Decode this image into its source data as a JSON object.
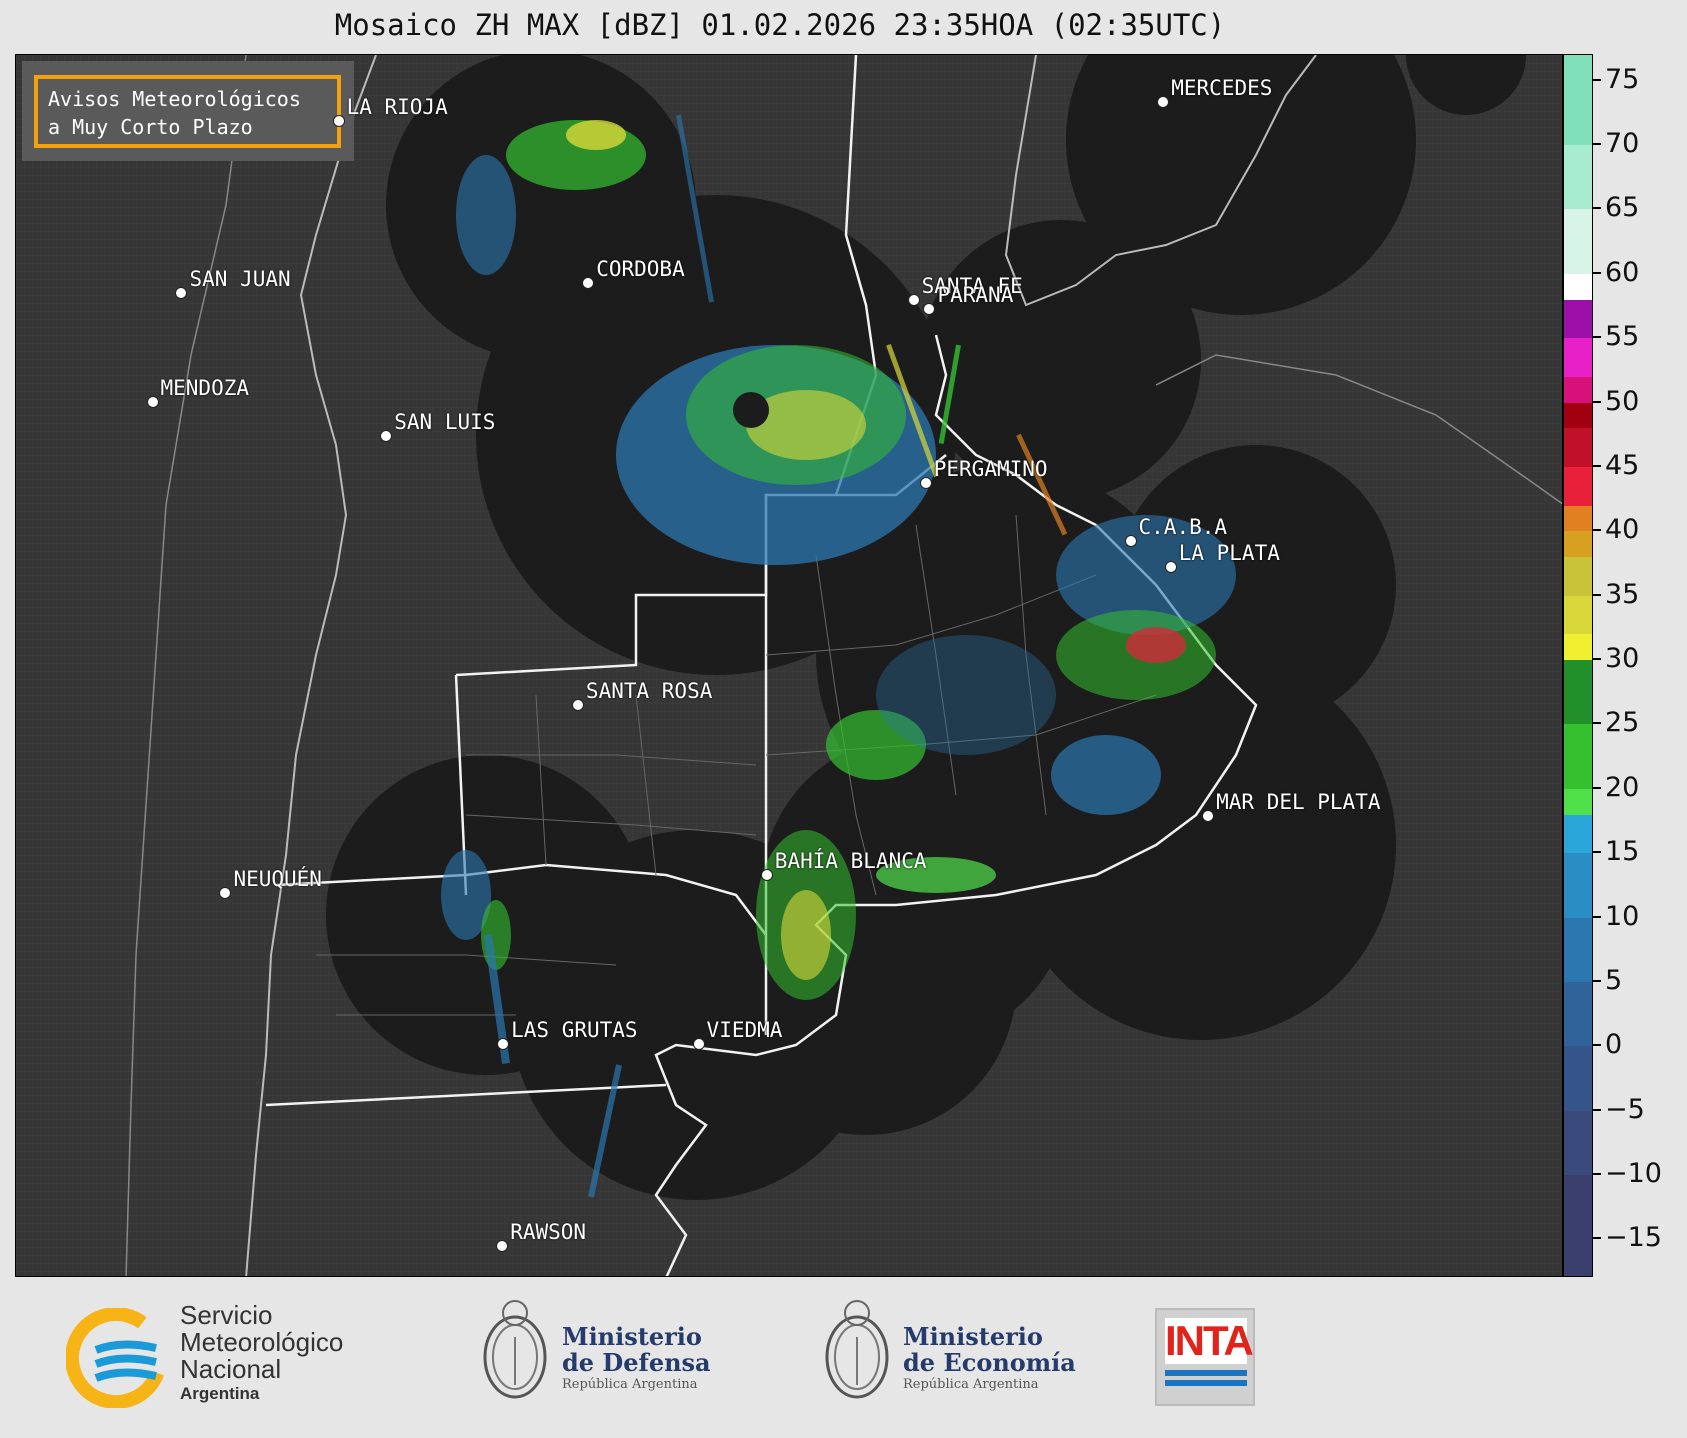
{
  "title": "Mosaico ZH MAX [dBZ] 01.02.2026 23:35HOA (02:35UTC)",
  "warning_box": {
    "line1": "Avisos Meteorológicos",
    "line2": "a Muy Corto Plazo",
    "border_color": "#f3a10c"
  },
  "cities": [
    {
      "name": "LA RIOJA",
      "lon": -66.85,
      "lat": -29.41
    },
    {
      "name": "MERCEDES",
      "lon": -58.03,
      "lat": -29.18
    },
    {
      "name": "SAN JUAN",
      "lon": -68.53,
      "lat": -31.54
    },
    {
      "name": "CORDOBA",
      "lon": -64.18,
      "lat": -31.42
    },
    {
      "name": "SANTA FE",
      "lon": -60.7,
      "lat": -31.63
    },
    {
      "name": "PARANA",
      "lon": -60.53,
      "lat": -31.73
    },
    {
      "name": "MENDOZA",
      "lon": -68.84,
      "lat": -32.89
    },
    {
      "name": "SAN LUIS",
      "lon": -66.34,
      "lat": -33.3
    },
    {
      "name": "PERGAMINO",
      "lon": -60.57,
      "lat": -33.89
    },
    {
      "name": "C.A.B.A",
      "lon": -58.38,
      "lat": -34.6
    },
    {
      "name": "LA PLATA",
      "lon": -57.95,
      "lat": -34.92
    },
    {
      "name": "SANTA ROSA",
      "lon": -64.29,
      "lat": -36.62
    },
    {
      "name": "MAR DEL PLATA",
      "lon": -57.55,
      "lat": -38.0
    },
    {
      "name": "BAHÍA BLANCA",
      "lon": -62.27,
      "lat": -38.72
    },
    {
      "name": "NEUQUÉN",
      "lon": -68.06,
      "lat": -38.95
    },
    {
      "name": "LAS GRUTAS",
      "lon": -65.09,
      "lat": -40.81
    },
    {
      "name": "VIEDMA",
      "lon": -63.0,
      "lat": -40.81
    },
    {
      "name": "RAWSON",
      "lon": -65.1,
      "lat": -43.3
    }
  ],
  "colorbar": {
    "min": -18,
    "max": 77,
    "ticks": [
      "75",
      "70",
      "65",
      "60",
      "55",
      "50",
      "45",
      "40",
      "35",
      "30",
      "25",
      "20",
      "15",
      "10",
      "5",
      "0",
      "−5",
      "−10",
      "−15"
    ],
    "tick_values": [
      75,
      70,
      65,
      60,
      55,
      50,
      45,
      40,
      35,
      30,
      25,
      20,
      15,
      10,
      5,
      0,
      -5,
      -10,
      -15
    ],
    "stops": [
      {
        "from": -18,
        "to": -10,
        "color": "#3a3f6e"
      },
      {
        "from": -10,
        "to": -5,
        "color": "#3a4a7a"
      },
      {
        "from": -5,
        "to": 0,
        "color": "#35558a"
      },
      {
        "from": 0,
        "to": 5,
        "color": "#2f6399"
      },
      {
        "from": 5,
        "to": 10,
        "color": "#2b78b0"
      },
      {
        "from": 10,
        "to": 15,
        "color": "#2a8ec4"
      },
      {
        "from": 15,
        "to": 18,
        "color": "#2aa6d8"
      },
      {
        "from": 18,
        "to": 20,
        "color": "#4fe04a"
      },
      {
        "from": 20,
        "to": 25,
        "color": "#35c030"
      },
      {
        "from": 25,
        "to": 30,
        "color": "#22902a"
      },
      {
        "from": 30,
        "to": 32,
        "color": "#f0f030"
      },
      {
        "from": 32,
        "to": 35,
        "color": "#d8d83a"
      },
      {
        "from": 35,
        "to": 38,
        "color": "#c8c43a"
      },
      {
        "from": 38,
        "to": 40,
        "color": "#d8a020"
      },
      {
        "from": 40,
        "to": 42,
        "color": "#e08020"
      },
      {
        "from": 42,
        "to": 45,
        "color": "#e8203a"
      },
      {
        "from": 45,
        "to": 48,
        "color": "#c0102a"
      },
      {
        "from": 48,
        "to": 50,
        "color": "#a00010"
      },
      {
        "from": 50,
        "to": 52,
        "color": "#d8107a"
      },
      {
        "from": 52,
        "to": 55,
        "color": "#e820c8"
      },
      {
        "from": 55,
        "to": 58,
        "color": "#9a10a8"
      },
      {
        "from": 58,
        "to": 60,
        "color": "#ffffff"
      },
      {
        "from": 60,
        "to": 65,
        "color": "#d8f4e8"
      },
      {
        "from": 65,
        "to": 70,
        "color": "#a8ecd0"
      },
      {
        "from": 70,
        "to": 77,
        "color": "#80e0bc"
      }
    ]
  },
  "footer": {
    "smn": {
      "line1": "Servicio",
      "line2": "Meteorológico",
      "line3": "Nacional",
      "line4": "Argentina"
    },
    "defensa": {
      "line1": "Ministerio",
      "line2": "de Defensa",
      "line3": "República Argentina"
    },
    "economia": {
      "line1": "Ministerio",
      "line2": "de Economía",
      "line3": "República Argentina"
    },
    "inta": {
      "label": "INTA"
    }
  }
}
